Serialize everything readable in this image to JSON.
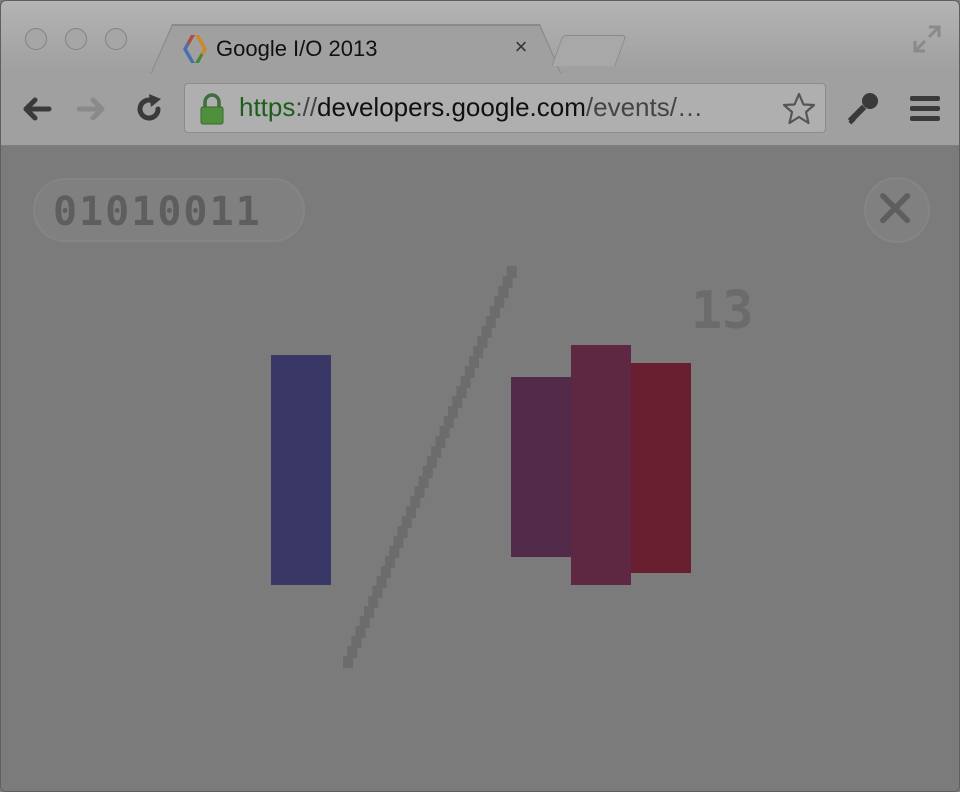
{
  "browser": {
    "tab_title": "Google I/O 2013",
    "tab_close": "×",
    "url_scheme": "https",
    "url_sep1": "://",
    "url_host": "developers.google.com",
    "url_path": "/events/…"
  },
  "page": {
    "binary_code": "01010011",
    "number": "13"
  },
  "colors": {
    "bar_i": "#393766",
    "bar_o1": "#522b4b",
    "bar_o2": "#5e2842",
    "bar_o3": "#6a1f30",
    "slash": "#6c6c6c"
  },
  "icons": {
    "favicon": "google-developers-icon",
    "back": "back-arrow-icon",
    "forward": "forward-arrow-icon",
    "reload": "reload-icon",
    "lock": "lock-icon",
    "star": "star-icon",
    "wrench": "key-icon",
    "menu": "menu-icon",
    "fullscreen": "fullscreen-icon",
    "close": "close-icon"
  }
}
